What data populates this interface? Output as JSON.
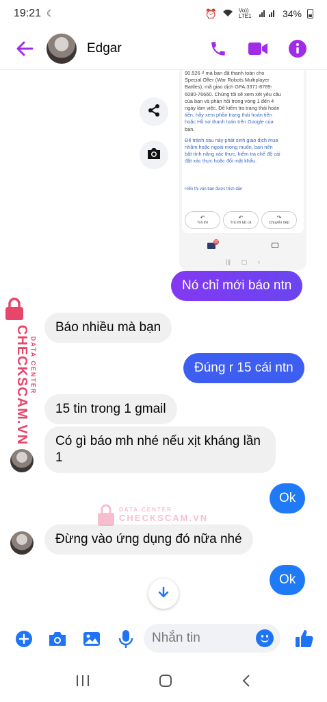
{
  "status_bar": {
    "time": "19:21",
    "battery": "34%",
    "network": "Vo)) LTE1"
  },
  "header": {
    "contact_name": "Edgar",
    "icons": [
      "back-arrow-icon",
      "phone-icon",
      "video-icon",
      "info-icon"
    ],
    "accent_color": "#a02ce8"
  },
  "shared_screenshot": {
    "body_lines": [
      "90.526 ₫ mà bạn đã thanh toán cho",
      "Special Offer (War Robots Multiplayer",
      "Battles), mã giao dịch GPA.3371-8789-",
      "6080-76660. Chúng tôi sẽ xem xét yêu cầu",
      "của bạn và phản hồi trong vòng 1 đến 4",
      "ngày làm việc. Để kiểm tra trạng thái hoàn",
      "tiền, hãy xem phần trạng thái hoàn tiền",
      "hoặc Hồ sơ thanh toán trên Google của",
      "bạn."
    ],
    "footer_lines": [
      "Để tránh sau này phát sinh giao dịch mua",
      "nhầm hoặc ngoài mong muốn, bạn nên",
      "bật tính năng xác thực, kiểm tra chế độ cài",
      "đặt xác thực hoặc đổi mật khẩu."
    ],
    "quoted_link": "Hiển thị văn bản được trích dẫn",
    "reply_buttons": [
      "Trả lời",
      "Trả lời tất cả",
      "Chuyển tiếp"
    ],
    "mail_badge": "99"
  },
  "messages": [
    {
      "from": "me",
      "text": "Nó chỉ mới báo ntn"
    },
    {
      "from": "them",
      "text": "Báo nhiều mà bạn"
    },
    {
      "from": "me",
      "text": "Đúng r 15 cái ntn"
    },
    {
      "from": "them",
      "text": "15 tin trong 1 gmail"
    },
    {
      "from": "them",
      "text": "Có gì báo mh nhé nếu xịt kháng lần 1"
    },
    {
      "from": "me",
      "text": "Ok"
    },
    {
      "from": "them",
      "text": "Đừng vào ứng dụng đó nữa nhé"
    },
    {
      "from": "me",
      "text": "Ok"
    }
  ],
  "watermark": {
    "label": "DATA CENTER",
    "brand": "CHECKSCAM.VN",
    "color": "#e8456b"
  },
  "composer": {
    "placeholder": "Nhắn tin",
    "icons": [
      "add-icon",
      "camera-icon",
      "gallery-icon",
      "mic-icon",
      "emoji-icon",
      "like-icon"
    ]
  },
  "nav_bar": {
    "icons": [
      "recents-icon",
      "home-icon",
      "back-icon"
    ]
  }
}
